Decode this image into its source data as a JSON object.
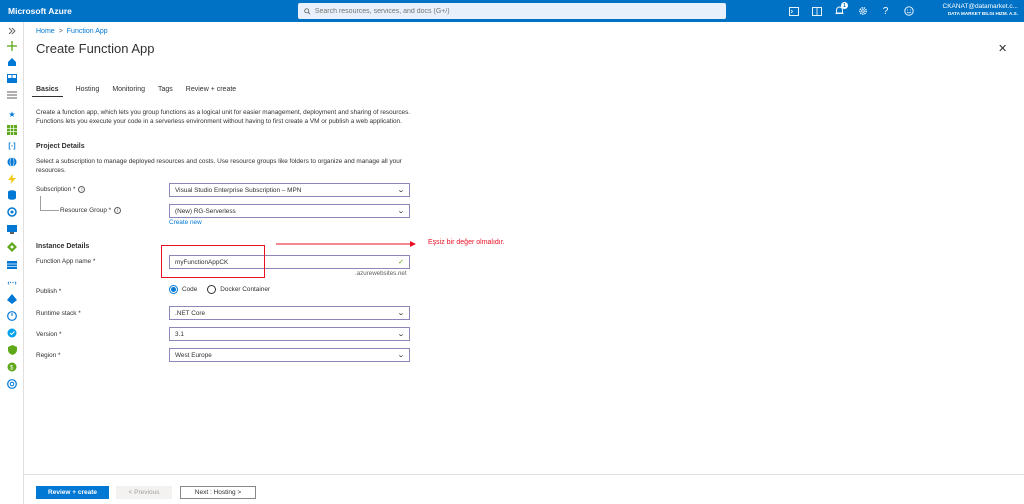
{
  "app": {
    "title": "Microsoft Azure"
  },
  "search": {
    "placeholder": "Search resources, services, and docs (G+/)"
  },
  "topbar": {
    "notification_count": "1"
  },
  "user": {
    "email": "CKANAT@datamarket.c...",
    "org": "DATA MARKET BILGI HIZM. A.S."
  },
  "breadcrumb": {
    "home": "Home",
    "current": "Function App",
    "sep": ">"
  },
  "page": {
    "title": "Create Function App",
    "close": "✕"
  },
  "tabs": [
    {
      "label": "Basics"
    },
    {
      "label": "Hosting"
    },
    {
      "label": "Monitoring"
    },
    {
      "label": "Tags"
    },
    {
      "label": "Review + create"
    }
  ],
  "intro": "Create a function app, which lets you group functions as a logical unit for easier management, deployment and sharing of resources. Functions lets you execute your code in a serverless environment without having to first create a VM or publish a web application.",
  "project": {
    "title": "Project Details",
    "desc": "Select a subscription to manage deployed resources and costs. Use resource groups like folders to organize and manage all your resources.",
    "subscription_label": "Subscription *",
    "subscription_value": "Visual Studio Enterprise Subscription – MPN",
    "rg_label": "Resource Group *",
    "rg_value": "(New) RG-Serverless",
    "create_new": "Create new"
  },
  "instance": {
    "title": "Instance Details",
    "name_label": "Function App name *",
    "name_value": "myFunctionAppCK",
    "suffix": ".azurewebsites.net",
    "publish_label": "Publish *",
    "publish_code": "Code",
    "publish_docker": "Docker Container",
    "runtime_label": "Runtime stack *",
    "runtime_value": ".NET Core",
    "version_label": "Version *",
    "version_value": "3.1",
    "region_label": "Region *",
    "region_value": "West Europe"
  },
  "annotation": {
    "text": "Eşsiz bir değer olmalıdır.",
    "color": "#e81123"
  },
  "footer": {
    "review_create": "Review + create",
    "previous": "< Previous",
    "next": "Next : Hosting >"
  },
  "colors": {
    "brand": "#0072c6",
    "accent": "#0078d4"
  }
}
